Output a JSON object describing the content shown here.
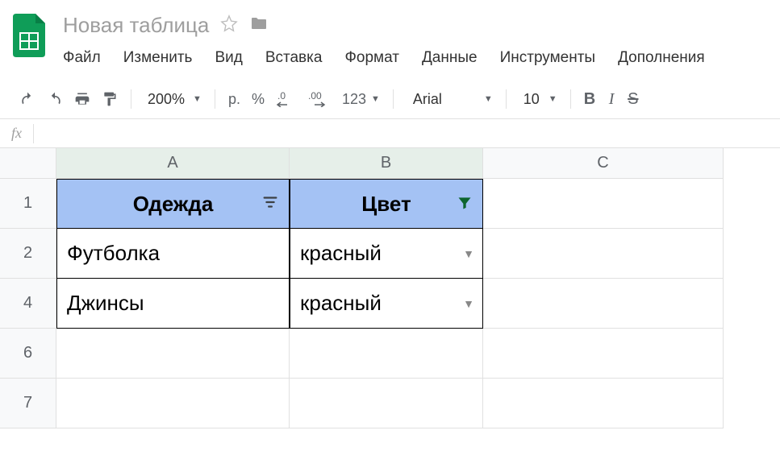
{
  "doc": {
    "title": "Новая таблица"
  },
  "menu": {
    "file": "Файл",
    "edit": "Изменить",
    "view": "Вид",
    "insert": "Вставка",
    "format": "Формат",
    "data": "Данные",
    "tools": "Инструменты",
    "addons": "Дополнения"
  },
  "toolbar": {
    "zoom": "200%",
    "currency": "р.",
    "percent": "%",
    "dec_dec": ".0",
    "dec_inc": ".00",
    "more_formats": "123",
    "font": "Arial",
    "font_size": "10"
  },
  "formula": {
    "fx": "fx",
    "value": ""
  },
  "columns": {
    "a": "A",
    "b": "B",
    "c": "C"
  },
  "rows": {
    "r1": "1",
    "r2": "2",
    "r4": "4",
    "r6": "6",
    "r7": "7"
  },
  "table": {
    "header_a": "Одежда",
    "header_b": "Цвет",
    "rows": [
      {
        "a": "Футболка",
        "b": "красный"
      },
      {
        "a": "Джинсы",
        "b": "красный"
      }
    ]
  }
}
